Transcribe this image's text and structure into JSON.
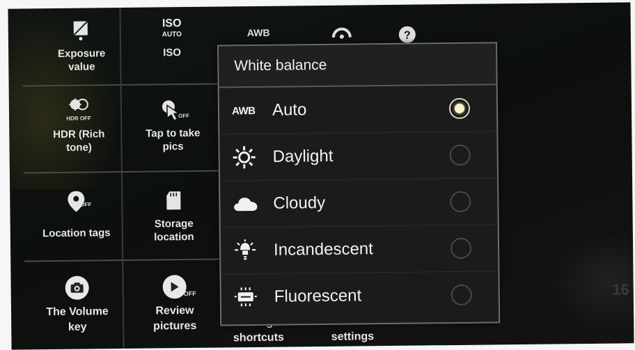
{
  "settings": {
    "exposure": "Exposure value",
    "iso_icon_top": "ISO",
    "iso_icon_bottom": "AUTO",
    "iso": "ISO",
    "hdr_icon": "HDR OFF",
    "hdr": "HDR (Rich tone)",
    "tap": "Tap to take pics",
    "tap_icon": "OFF",
    "location": "Location tags",
    "location_icon": "OFF",
    "storage": "Storage location",
    "volume": "The Volume key",
    "review": "Review pictures",
    "review_icon": "OFF",
    "manage": "Manage shortcuts",
    "reset": "Reset settings"
  },
  "top_icons": {
    "awb": "AWB"
  },
  "white_balance": {
    "title": "White balance",
    "options": [
      {
        "label": "Auto",
        "icon_text": "AWB",
        "icon": "awb-icon",
        "selected": true
      },
      {
        "label": "Daylight",
        "icon": "sun-icon",
        "selected": false
      },
      {
        "label": "Cloudy",
        "icon": "cloud-icon",
        "selected": false
      },
      {
        "label": "Incandescent",
        "icon": "bulb-icon",
        "selected": false
      },
      {
        "label": "Fluorescent",
        "icon": "fluorescent-icon",
        "selected": false
      }
    ]
  },
  "side_text": "16"
}
